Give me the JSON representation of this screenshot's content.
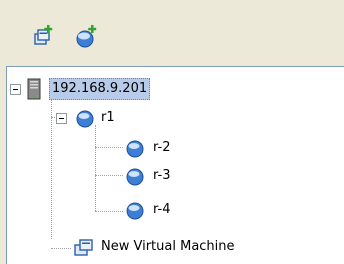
{
  "toolbar": {
    "buttons": [
      {
        "icon": "new-vm-icon"
      },
      {
        "icon": "new-resource-pool-icon"
      }
    ]
  },
  "tree": {
    "host": {
      "label": "192.168.9.201",
      "icon": "server-icon",
      "expanded": true,
      "selected": true
    },
    "pool": {
      "label": "r1",
      "icon": "resource-pool-icon",
      "expanded": true
    },
    "children": [
      {
        "label": "r-2",
        "icon": "resource-pool-icon"
      },
      {
        "label": "r-3",
        "icon": "resource-pool-icon"
      },
      {
        "label": "r-4",
        "icon": "resource-pool-icon"
      }
    ],
    "vm": {
      "label": "New Virtual Machine",
      "icon": "virtual-machine-icon"
    }
  },
  "colors": {
    "panel_background": "#ece9d8",
    "tree_background": "#ffffff",
    "selection": "#b8cbe8",
    "plus_green": "#2fa52f",
    "pool_blue": "#3c7fd6"
  }
}
